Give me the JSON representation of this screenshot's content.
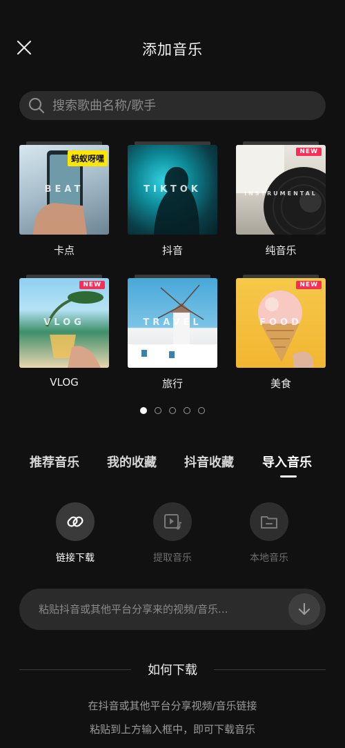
{
  "header": {
    "title": "添加音乐",
    "close_icon": "close-icon"
  },
  "search": {
    "placeholder": "搜索歌曲名称/歌手",
    "icon": "search-icon"
  },
  "categories": [
    {
      "label": "卡点",
      "cover_text": "BEAT",
      "badge": "蚂蚁呀嘿",
      "badge_color": "#ffe600"
    },
    {
      "label": "抖音",
      "cover_text": "TIKTOK",
      "badge": ""
    },
    {
      "label": "纯音乐",
      "cover_text": "INSTRUMENTAL",
      "badge": "NEW",
      "badge_color": "#fe2c55"
    },
    {
      "label": "VLOG",
      "cover_text": "VLOG",
      "badge": "NEW",
      "badge_color": "#fe2c55"
    },
    {
      "label": "旅行",
      "cover_text": "TRAVEL",
      "badge": ""
    },
    {
      "label": "美食",
      "cover_text": "FOOD",
      "badge": "NEW",
      "badge_color": "#fe2c55"
    }
  ],
  "pagination": {
    "total": 5,
    "active": 1
  },
  "tabs": [
    {
      "label": "推荐音乐",
      "active": false
    },
    {
      "label": "我的收藏",
      "active": false
    },
    {
      "label": "抖音收藏",
      "active": false
    },
    {
      "label": "导入音乐",
      "active": true
    }
  ],
  "import_actions": [
    {
      "label": "链接下载",
      "icon": "link-icon",
      "active": true
    },
    {
      "label": "提取音乐",
      "icon": "video-music-icon",
      "active": false
    },
    {
      "label": "本地音乐",
      "icon": "folder-icon",
      "active": false
    }
  ],
  "paste_field": {
    "placeholder": "粘贴抖音或其他平台分享来的视频/音乐...",
    "button_icon": "download-arrow-icon"
  },
  "how_to": {
    "title": "如何下载",
    "lines": [
      "在抖音或其他平台分享视频/音乐链接",
      "粘贴到上方输入框中，即可下载音乐"
    ]
  },
  "colors": {
    "background": "#111111",
    "surface": "#2b2b2b",
    "accent_new": "#fe2c55",
    "accent_yellow": "#ffe600"
  }
}
